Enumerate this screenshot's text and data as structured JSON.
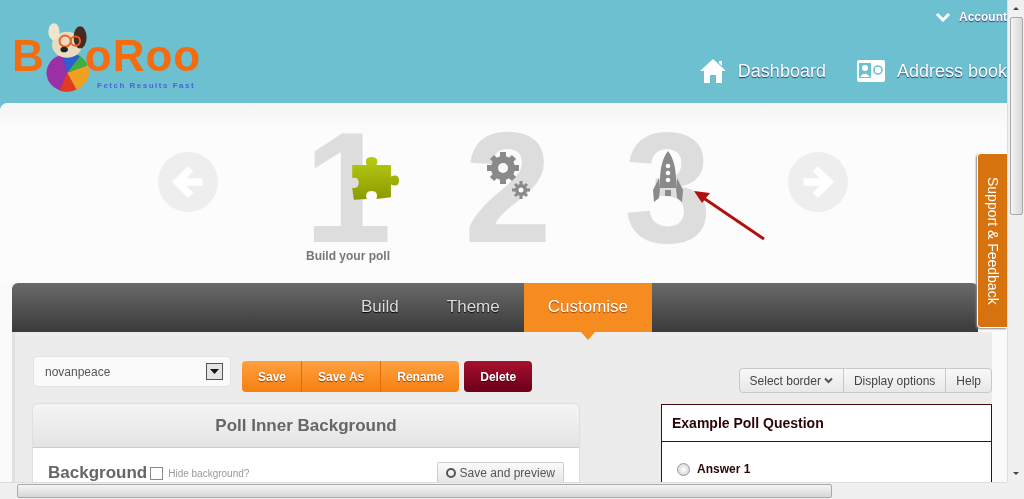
{
  "header": {
    "logo": {
      "name_start": "B",
      "name_end": "oRoo",
      "tagline": "Fetch Results Fast"
    },
    "account": {
      "label": "Account"
    },
    "nav": [
      {
        "label": "Dashboard",
        "kind": "home"
      },
      {
        "label": "Address book",
        "kind": "contacts"
      }
    ]
  },
  "steps": [
    {
      "number": "1",
      "kind": "puzzle",
      "label": "Build your poll",
      "selected": true
    },
    {
      "number": "2",
      "kind": "gears",
      "selected": false
    },
    {
      "number": "3",
      "kind": "rocket",
      "selected": false
    }
  ],
  "tabs": [
    {
      "label": "Build",
      "selected": false
    },
    {
      "label": "Theme",
      "selected": false
    },
    {
      "label": "Customise",
      "selected": true
    }
  ],
  "theme_select": {
    "value": "novanpeace"
  },
  "actions": [
    {
      "label": "Save",
      "kind": "primary"
    },
    {
      "label": "Save As",
      "kind": "primary"
    },
    {
      "label": "Rename",
      "kind": "primary"
    },
    {
      "label": "Delete",
      "kind": "danger"
    }
  ],
  "options": [
    {
      "label": "Select border",
      "kind": "menu"
    },
    {
      "label": "Display options",
      "kind": "plain"
    },
    {
      "label": "Help",
      "kind": "plain"
    }
  ],
  "settings_panel": {
    "title": "Poll Inner Background",
    "section": "Background",
    "hide_checkbox": {
      "label": "Hide background?",
      "checked": false
    },
    "preview_button": "Save and preview"
  },
  "preview": {
    "question": "Example Poll Question",
    "answers": [
      {
        "label": "Answer 1",
        "selected": false
      }
    ]
  },
  "support_tab": {
    "label": "Support & Feedback"
  }
}
